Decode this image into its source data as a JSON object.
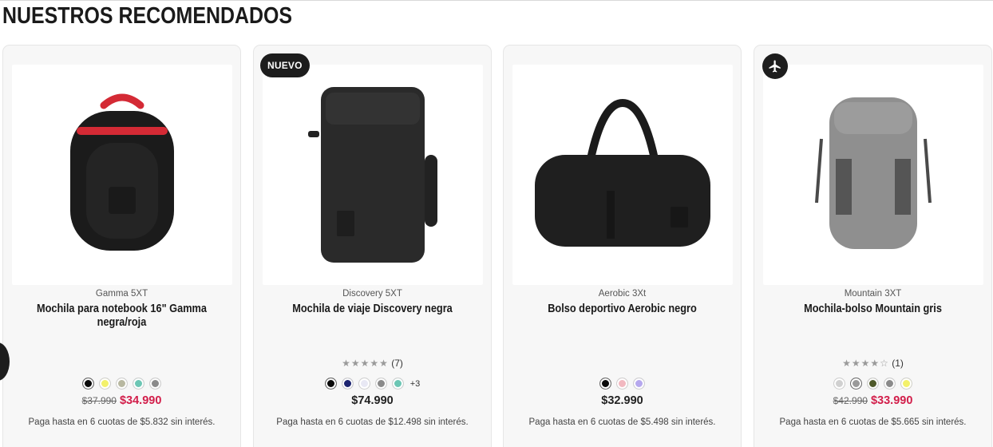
{
  "section": {
    "title": "NUESTROS RECOMENDADOS"
  },
  "products": [
    {
      "brand": "Gamma 5XT",
      "name": "Mochila para notebook 16\" Gamma negra/roja",
      "badge": "",
      "rating": null,
      "swatches": [
        "#0a0a0a",
        "#f3f16a",
        "#b8b8a0",
        "#6cc6b4",
        "#8a8a8a"
      ],
      "more_colors": "",
      "old_price": "$37.990",
      "price": "$34.990",
      "price_sale": true,
      "installments": "Paga hasta en 6 cuotas de $5.832 sin interés."
    },
    {
      "brand": "Discovery 5XT",
      "name": "Mochila de viaje Discovery negra",
      "badge": "NUEVO",
      "rating": {
        "stars": "★★★★★",
        "count": "(7)"
      },
      "swatches": [
        "#0a0a0a",
        "#1c2470",
        "#e8e8f4",
        "#8a8a8a",
        "#6cc6b4"
      ],
      "more_colors": "+3",
      "old_price": "",
      "price": "$74.990",
      "price_sale": false,
      "installments": "Paga hasta en 6 cuotas de $12.498 sin interés."
    },
    {
      "brand": "Aerobic 3Xt",
      "name": "Bolso deportivo Aerobic negro",
      "badge": "",
      "rating": null,
      "swatches": [
        "#0a0a0a",
        "#f2b8c0",
        "#b6a8ee"
      ],
      "more_colors": "",
      "old_price": "",
      "price": "$32.990",
      "price_sale": false,
      "installments": "Paga hasta en 6 cuotas de $5.498 sin interés."
    },
    {
      "brand": "Mountain 3XT",
      "name": "Mochila-bolso Mountain gris",
      "badge": "plane-icon",
      "rating": {
        "stars": "★★★★☆",
        "count": "(1)"
      },
      "swatches": [
        "#d0d0d0",
        "#9a9a9a",
        "#4f5a2a",
        "#8a8a8a",
        "#f3f16a"
      ],
      "more_colors": "",
      "old_price": "$42.990",
      "price": "$33.990",
      "price_sale": true,
      "installments": "Paga hasta en 6 cuotas de $5.665 sin interés."
    }
  ],
  "colors": {
    "sale": "#d21e4a",
    "badge_bg": "#1d1d1d"
  }
}
